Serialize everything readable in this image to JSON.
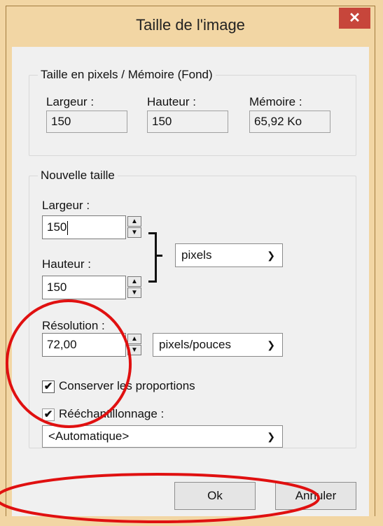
{
  "window": {
    "title": "Taille de l'image",
    "close_label": "✕"
  },
  "pixel_group": {
    "legend": "Taille en pixels / Mémoire (Fond)",
    "width_label": "Largeur :",
    "width_value": "150",
    "height_label": "Hauteur :",
    "height_value": "150",
    "memory_label": "Mémoire :",
    "memory_value": "65,92 Ko"
  },
  "new_size_group": {
    "legend": "Nouvelle taille",
    "width_label": "Largeur :",
    "width_value": "150",
    "height_label": "Hauteur :",
    "height_value": "150",
    "unit_select": "pixels",
    "resolution_label": "Résolution :",
    "resolution_value": "72,00",
    "resolution_unit_select": "pixels/pouces",
    "keep_proportions_label": "Conserver les proportions",
    "keep_proportions_checked": true,
    "resample_label": "Rééchantillonnage :",
    "resample_checked": true,
    "resample_method_select": "<Automatique>"
  },
  "buttons": {
    "ok": "Ok",
    "cancel": "Annuler"
  },
  "annotation_color": "#e01010",
  "icons": [
    "close-icon",
    "spin-up-icon",
    "spin-down-icon",
    "chevron-down-icon",
    "checkmark-icon"
  ]
}
